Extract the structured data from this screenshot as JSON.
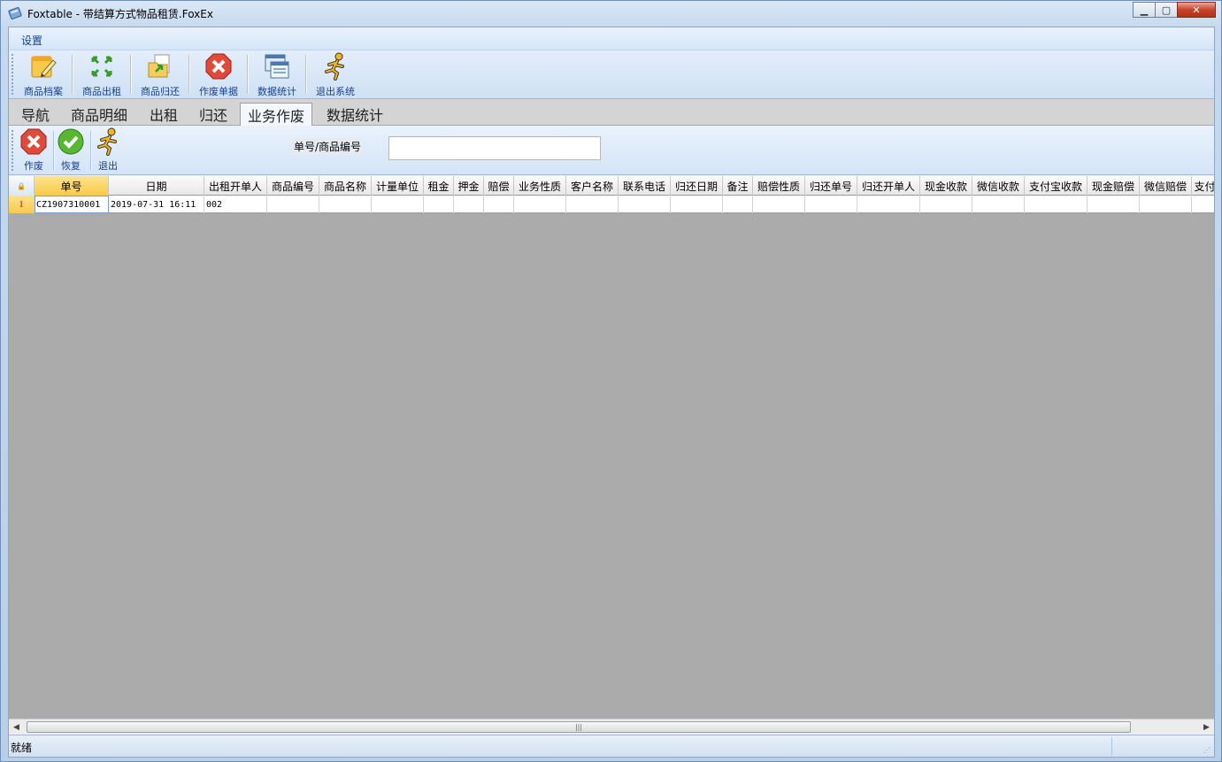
{
  "window": {
    "title": "Foxtable - 带结算方式物品租赁.FoxEx",
    "min_label": "▁",
    "max_label": "▢",
    "close_label": "✕"
  },
  "menu": {
    "settings": "设置"
  },
  "ribbon": {
    "items": [
      {
        "label": "商品档案",
        "icon": "notepad-edit-icon"
      },
      {
        "label": "商品出租",
        "icon": "arrows-out-icon"
      },
      {
        "label": "商品归还",
        "icon": "folder-return-icon"
      },
      {
        "label": "作废单据",
        "icon": "red-x-icon"
      },
      {
        "label": "数据统计",
        "icon": "statistics-window-icon"
      },
      {
        "label": "退出系统",
        "icon": "running-man-icon"
      }
    ]
  },
  "tabs": [
    "导航",
    "商品明细",
    "出租",
    "归还",
    "业务作废",
    "数据统计"
  ],
  "active_tab": "业务作废",
  "page_toolbar": {
    "void_label": "作废",
    "restore_label": "恢复",
    "exit_label": "退出",
    "search_label": "单号/商品编号",
    "search_value": ""
  },
  "grid": {
    "lock_glyph": "🔒",
    "columns": [
      "单号",
      "日期",
      "出租开单人",
      "商品编号",
      "商品名称",
      "计量单位",
      "租金",
      "押金",
      "赔偿",
      "业务性质",
      "客户名称",
      "联系电话",
      "归还日期",
      "备注",
      "赔偿性质",
      "归还单号",
      "归还开单人",
      "现金收款",
      "微信收款",
      "支付宝收款",
      "现金赔偿",
      "微信赔偿",
      "支付"
    ],
    "rows": [
      {
        "num": "1",
        "cells": [
          "CZ1907310001",
          "2019-07-31 16:11",
          "002",
          "",
          "",
          "",
          "",
          "",
          "",
          "",
          "",
          "",
          "",
          "",
          "",
          "",
          "",
          "",
          "",
          "",
          "",
          "",
          ""
        ]
      }
    ]
  },
  "status": {
    "text": "就绪"
  },
  "colors": {
    "accent": "#15428b",
    "selected_header": "#f8c94a",
    "grid_bg": "#ababab"
  }
}
